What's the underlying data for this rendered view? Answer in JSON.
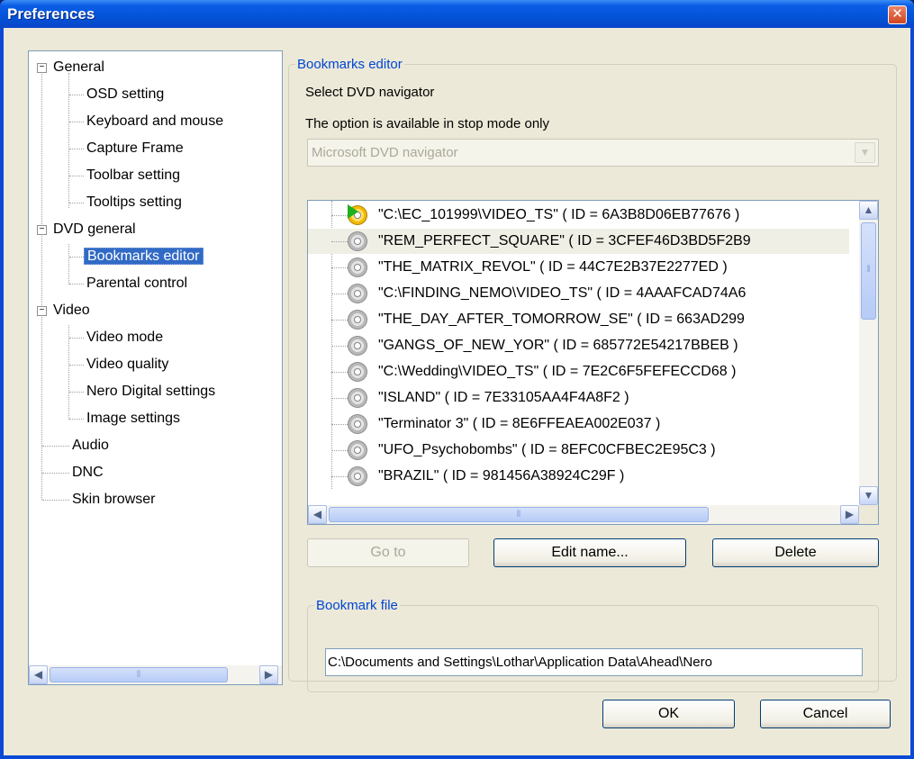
{
  "window": {
    "title": "Preferences",
    "close_glyph": "✕"
  },
  "tree": {
    "items": [
      {
        "label": "General"
      },
      {
        "label": "OSD setting"
      },
      {
        "label": "Keyboard and mouse"
      },
      {
        "label": "Capture Frame"
      },
      {
        "label": "Toolbar setting"
      },
      {
        "label": "Tooltips setting"
      },
      {
        "label": "DVD general"
      },
      {
        "label": "Bookmarks editor"
      },
      {
        "label": "Parental control"
      },
      {
        "label": "Video"
      },
      {
        "label": "Video mode"
      },
      {
        "label": "Video quality"
      },
      {
        "label": "Nero Digital settings"
      },
      {
        "label": "Image settings"
      },
      {
        "label": "Audio"
      },
      {
        "label": "DNC"
      },
      {
        "label": "Skin browser"
      }
    ],
    "selected": "Bookmarks editor"
  },
  "bookmarks_editor": {
    "group_title": "Bookmarks editor",
    "select_label": "Select DVD navigator",
    "note": "The option is available in stop mode only",
    "navigator_value": "Microsoft DVD navigator",
    "entries": [
      "\"C:\\EC_101999\\VIDEO_TS\" ( ID = 6A3B8D06EB77676 )",
      "\"REM_PERFECT_SQUARE\" ( ID = 3CFEF46D3BD5F2B9",
      "\"THE_MATRIX_REVOL\" ( ID = 44C7E2B37E2277ED )",
      "\"C:\\FINDING_NEMO\\VIDEO_TS\" ( ID = 4AAAFCAD74A6",
      "\"THE_DAY_AFTER_TOMORROW_SE\" ( ID = 663AD299",
      "\"GANGS_OF_NEW_YOR\" ( ID = 685772E54217BBEB )",
      "\"C:\\Wedding\\VIDEO_TS\" ( ID = 7E2C6F5FEFECCD68 )",
      "\"ISLAND\" ( ID = 7E33105AA4F4A8F2 )",
      "\"Terminator 3\" ( ID = 8E6FFEAEA002E037 )",
      "\"UFO_Psychobombs\" ( ID = 8EFC0CFBEC2E95C3 )",
      "\"BRAZIL\" ( ID = 981456A38924C29F )"
    ],
    "buttons": {
      "goto": "Go to",
      "edit": "Edit name...",
      "delete": "Delete"
    }
  },
  "bookmark_file": {
    "group_title": "Bookmark file",
    "path": "C:\\Documents and Settings\\Lothar\\Application Data\\Ahead\\Nero"
  },
  "footer": {
    "ok": "OK",
    "cancel": "Cancel"
  },
  "scroll_glyphs": {
    "left": "◀",
    "right": "▶",
    "up": "▲",
    "down": "▼",
    "grip": "⦀"
  },
  "colors": {
    "titlebar": "#0453d8",
    "selection": "#316ac5",
    "legend": "#0046d5",
    "dialog": "#ece9d8"
  }
}
